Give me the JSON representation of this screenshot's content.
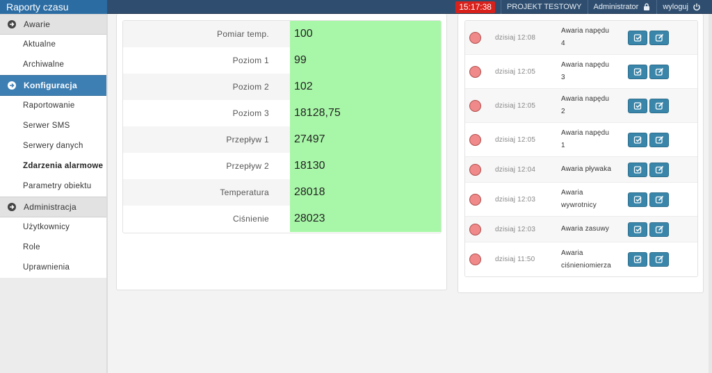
{
  "app": {
    "title": "Raporty czasu"
  },
  "topbar": {
    "clock": "15:17:38",
    "project": "PROJEKT TESTOWY",
    "user": "Administrator",
    "logout": "wyloguj"
  },
  "sidebar": {
    "sections": [
      {
        "label": "Awarie",
        "items": [
          "Aktualne",
          "Archiwalne"
        ]
      },
      {
        "label": "Konfiguracja",
        "items": [
          "Raportowanie",
          "Serwer SMS",
          "Serwery danych",
          "Zdarzenia alarmowe",
          "Parametry obiektu"
        ]
      },
      {
        "label": "Administracja",
        "items": [
          "Użytkownicy",
          "Role",
          "Uprawnienia"
        ]
      }
    ]
  },
  "measurements": [
    {
      "label": "Pomiar temp.",
      "value": "100"
    },
    {
      "label": "Poziom 1",
      "value": "99"
    },
    {
      "label": "Poziom 2",
      "value": "102"
    },
    {
      "label": "Poziom 3",
      "value": "18128,75"
    },
    {
      "label": "Przepływ 1",
      "value": "27497"
    },
    {
      "label": "Przepływ 2",
      "value": "18130"
    },
    {
      "label": "Temperatura",
      "value": "28018"
    },
    {
      "label": "Ciśnienie",
      "value": "28023"
    }
  ],
  "alarms": [
    {
      "time": "dzisiaj 12:08",
      "name_1": "Awaria napędu",
      "name_2": "4"
    },
    {
      "time": "dzisiaj 12:05",
      "name_1": "Awaria napędu",
      "name_2": "3"
    },
    {
      "time": "dzisiaj 12:05",
      "name_1": "Awaria napędu",
      "name_2": "2"
    },
    {
      "time": "dzisiaj 12:05",
      "name_1": "Awaria napędu",
      "name_2": "1"
    },
    {
      "time": "dzisiaj 12:04",
      "name_1": "Awaria pływaka",
      "name_2": ""
    },
    {
      "time": "dzisiaj 12:03",
      "name_1": "Awaria",
      "name_2": "wywrotnicy"
    },
    {
      "time": "dzisiaj 12:03",
      "name_1": "Awaria zasuwy",
      "name_2": ""
    },
    {
      "time": "dzisiaj 11:50",
      "name_1": "Awaria",
      "name_2": "ciśnieniomierza"
    }
  ],
  "icons": {
    "section": "circle-arrow-right-icon",
    "lock": "lock-icon",
    "power": "power-icon",
    "confirm": "check-square-icon",
    "edit": "edit-icon"
  },
  "colors": {
    "topbar": "#2f4e6f",
    "brand": "#2b6ca3",
    "active_section": "#3e7fb3",
    "clock_bg": "#d9211b",
    "value_bg": "#a8f7a8",
    "alarm_dot": "#f08a8a",
    "action_button": "#3a86aa"
  }
}
